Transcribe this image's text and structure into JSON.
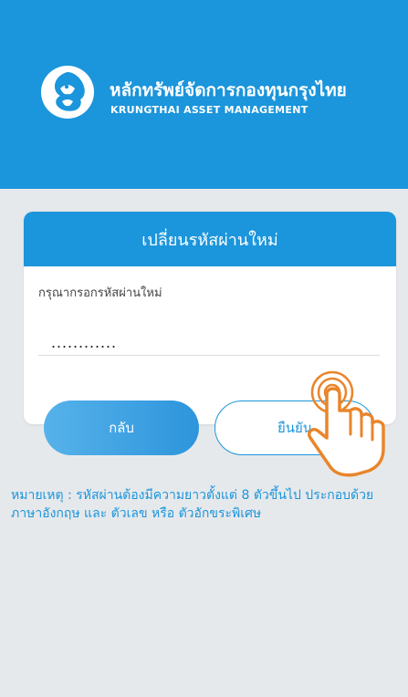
{
  "header": {
    "brand_th": "หลักทรัพย์จัดการกองทุนกรุงไทย",
    "brand_en": "KRUNGTHAI ASSET MANAGEMENT",
    "logo_icon": "garuda-logo-icon",
    "bg_color": "#1b95db"
  },
  "card": {
    "title": "เปลี่ยนรหัสผ่านใหม่",
    "field_label": "กรุณากรอกรหัสผ่านใหม่",
    "password_value": "............"
  },
  "buttons": {
    "back": "กลับ",
    "confirm": "ยืนยัน"
  },
  "note": "หมายเหตุ : รหัสผ่านต้องมีความยาวตั้งแต่ 8 ตัวขึ้นไป ประกอบด้วยภาษาอังกฤษ และ ตัวเลข หรือ ตัวอักขระพิเศษ",
  "overlay": {
    "icon": "tap-hand-icon",
    "color": "#e9852b"
  }
}
